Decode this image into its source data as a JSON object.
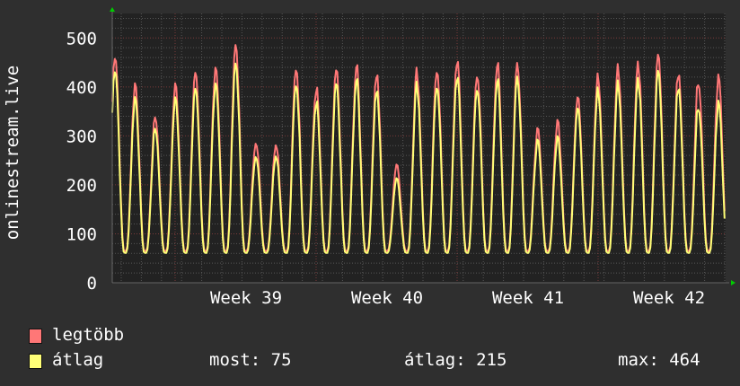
{
  "chart_data": {
    "type": "line",
    "ylabel": "onlinestream.live",
    "ylim": [
      0,
      550
    ],
    "yticks": [
      "0",
      "100",
      "200",
      "300",
      "400",
      "500"
    ],
    "xticks": [
      "Week 39",
      "Week 40",
      "Week 41",
      "Week 42"
    ],
    "grid": true,
    "series": [
      {
        "name": "legtöbb",
        "color": "#ff7777",
        "daily_peaks": [
          485,
          420,
          350,
          415,
          445,
          460,
          500,
          300,
          295,
          455,
          410,
          445,
          455,
          440,
          250,
          445,
          455,
          470,
          445,
          460,
          465,
          320,
          340,
          400,
          435,
          455,
          460,
          480,
          440,
          430
        ]
      },
      {
        "name": "átlag",
        "color": "#ffff77",
        "daily_peaks": [
          460,
          395,
          330,
          390,
          415,
          430,
          465,
          275,
          275,
          425,
          385,
          420,
          430,
          410,
          225,
          420,
          425,
          440,
          420,
          430,
          440,
          300,
          310,
          380,
          410,
          425,
          430,
          450,
          415,
          380
        ]
      }
    ],
    "daily_min": 65,
    "legend": {
      "placement": "bottom-left"
    },
    "stats": {
      "most_label": "most:",
      "most": "75",
      "atlag_label": "átlag:",
      "atlag": "215",
      "max_label": "max:",
      "max": "464"
    }
  }
}
